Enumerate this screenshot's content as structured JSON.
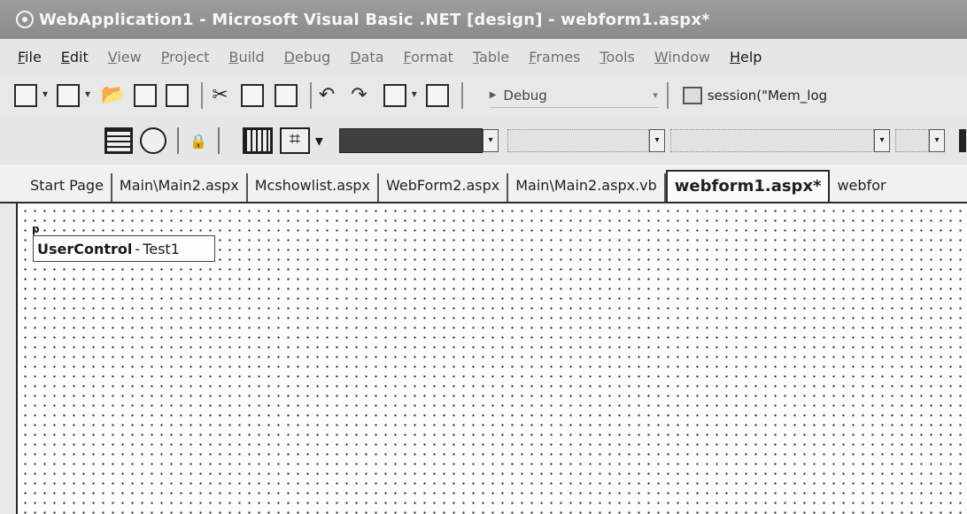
{
  "window": {
    "title": "WebApplication1 - Microsoft Visual Basic .NET [design] - webform1.aspx*"
  },
  "menu": [
    {
      "label": "File",
      "dim": false
    },
    {
      "label": "Edit",
      "dim": false
    },
    {
      "label": "View",
      "dim": true
    },
    {
      "label": "Project",
      "dim": true
    },
    {
      "label": "Build",
      "dim": true
    },
    {
      "label": "Debug",
      "dim": true
    },
    {
      "label": "Data",
      "dim": true
    },
    {
      "label": "Format",
      "dim": true
    },
    {
      "label": "Table",
      "dim": true
    },
    {
      "label": "Frames",
      "dim": true
    },
    {
      "label": "Tools",
      "dim": true
    },
    {
      "label": "Window",
      "dim": true
    },
    {
      "label": "Help",
      "dim": false
    }
  ],
  "toolbar": {
    "config": "Debug",
    "find_text": "session(\"Mem_log"
  },
  "tabs": [
    "Start Page",
    "Main\\Main2.aspx",
    "Mcshowlist.aspx",
    "WebForm2.aspx",
    "Main\\Main2.aspx.vb",
    "webform1.aspx*",
    "webfor"
  ],
  "active_tab": 5,
  "designer": {
    "control_name": "UserControl",
    "separator": "-",
    "control_id": "Test1",
    "handle": "p"
  },
  "colors": {
    "titlebar": "#8f8f8f",
    "surface": "#fdfdfd",
    "grid_dots": "#222222"
  }
}
